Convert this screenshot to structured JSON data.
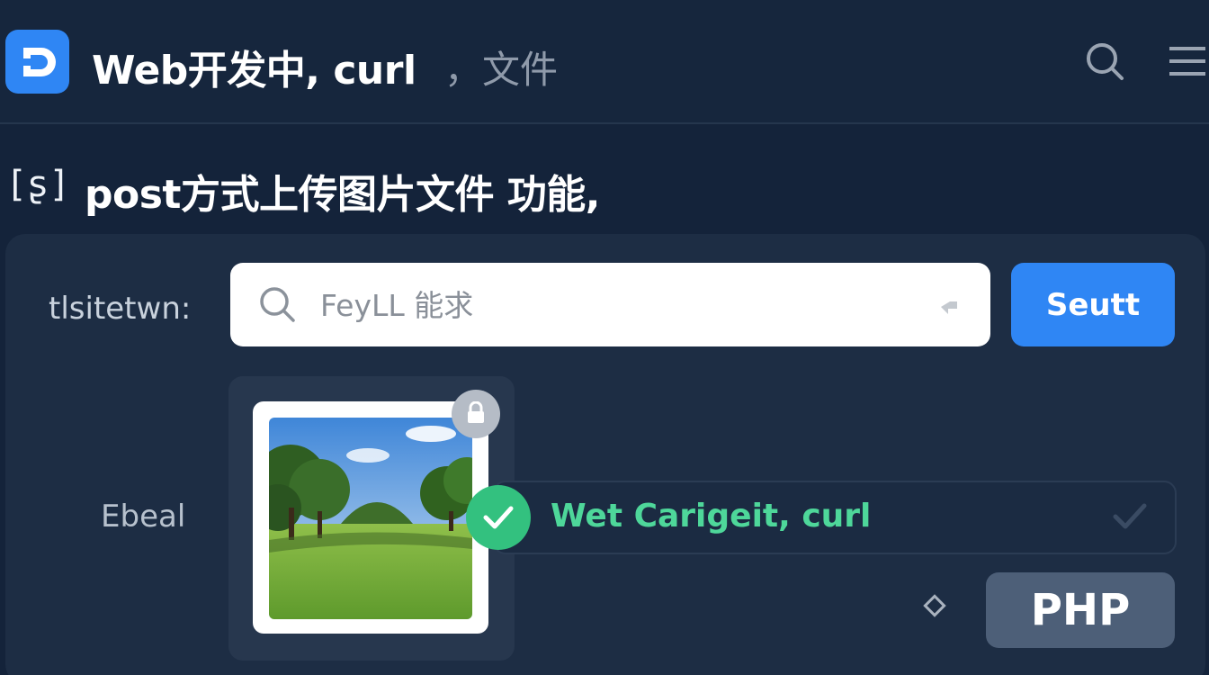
{
  "header": {
    "title": "Web开发中, curl",
    "subtitle": "，文件",
    "logo_icon": "app-logo-icon",
    "search_icon": "search-icon",
    "menu_icon": "menu-icon"
  },
  "section": {
    "icon_text": "[ʂ]",
    "title": "post方式上传图片文件 功能,"
  },
  "form": {
    "field_label": "tlsitetwn:",
    "search_placeholder": "FeyLL 能求",
    "submit_label": "Seutt",
    "file_label": "Ebeal"
  },
  "result": {
    "text": "Wet Carigeit, curl",
    "status_color": "#33c17f"
  },
  "lang_badge": "PHP",
  "colors": {
    "accent": "#2f86f4",
    "background": "#14233a",
    "card": "#1d2d44",
    "success": "#4ed79a"
  }
}
